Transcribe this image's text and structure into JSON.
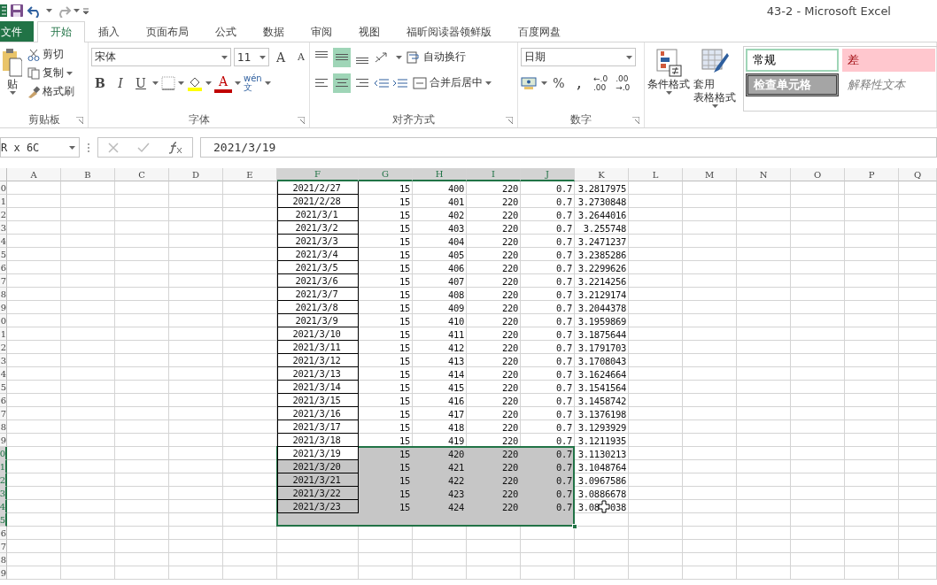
{
  "window": {
    "title": "43-2 - Microsoft Excel"
  },
  "tabs": [
    {
      "label": "文件",
      "kind": "file",
      "selected": false
    },
    {
      "label": "开始",
      "kind": "tab",
      "selected": true
    },
    {
      "label": "插入",
      "kind": "tab",
      "selected": false
    },
    {
      "label": "页面布局",
      "kind": "tab",
      "selected": false
    },
    {
      "label": "公式",
      "kind": "tab",
      "selected": false
    },
    {
      "label": "数据",
      "kind": "tab",
      "selected": false
    },
    {
      "label": "审阅",
      "kind": "tab",
      "selected": false
    },
    {
      "label": "视图",
      "kind": "tab",
      "selected": false
    },
    {
      "label": "福昕阅读器领鲜版",
      "kind": "tab",
      "selected": false
    },
    {
      "label": "百度网盘",
      "kind": "tab",
      "selected": false
    }
  ],
  "clipboard": {
    "paste": "贴",
    "cut": "剪切",
    "copy": "复制",
    "format_painter": "格式刷",
    "label": "剪贴板"
  },
  "font": {
    "name": "宋体",
    "size": "11",
    "grow": "A",
    "shrink": "A",
    "bold": "B",
    "italic": "I",
    "underline": "U",
    "color_button": "A",
    "phonetic_top": "wén",
    "phonetic_bottom": "文",
    "label": "字体"
  },
  "alignment": {
    "vertical": [
      {
        "selected": false
      },
      {
        "selected": true
      },
      {
        "selected": false
      }
    ],
    "horizontal": [
      {
        "selected": false
      },
      {
        "selected": true
      },
      {
        "selected": false
      }
    ],
    "wrap": "自动换行",
    "merge": "合并后居中",
    "label": "对齐方式"
  },
  "number": {
    "format": "日期",
    "percent": "%",
    "comma": ",",
    "decimals": [
      {
        "top": "←.0",
        "bottom": ".00"
      },
      {
        "top": ".00",
        "bottom": "→.0"
      }
    ],
    "label": "数字"
  },
  "styles": {
    "conditional": "条件格式",
    "table_top": "套用",
    "table_bottom": "表格格式",
    "gallery": [
      {
        "label": "常规",
        "kind": "normal"
      },
      {
        "label": "差",
        "kind": "bad"
      },
      {
        "label": "检查单元格",
        "kind": "check"
      },
      {
        "label": "解释性文本",
        "kind": "note"
      }
    ]
  },
  "formula_bar": {
    "name_box": "R x 6C",
    "value": "2021/3/19"
  },
  "sheet": {
    "columns": [
      {
        "label": "A",
        "selected": false
      },
      {
        "label": "B",
        "selected": false
      },
      {
        "label": "C",
        "selected": false
      },
      {
        "label": "D",
        "selected": false
      },
      {
        "label": "E",
        "selected": false
      },
      {
        "label": "F",
        "selected": true,
        "active": true
      },
      {
        "label": "G",
        "selected": true
      },
      {
        "label": "H",
        "selected": true
      },
      {
        "label": "I",
        "selected": true
      },
      {
        "label": "J",
        "selected": true
      },
      {
        "label": "K",
        "selected": false
      },
      {
        "label": "L",
        "selected": false
      },
      {
        "label": "M",
        "selected": false
      },
      {
        "label": "N",
        "selected": false
      },
      {
        "label": "O",
        "selected": false
      },
      {
        "label": "P",
        "selected": false
      },
      {
        "label": "Q",
        "selected": false
      }
    ],
    "rows": [
      {
        "header": "0",
        "selected": false,
        "cells": [
          "2021/2/27",
          "15",
          "400",
          "220",
          "0.7",
          "3.2817975"
        ]
      },
      {
        "header": "1",
        "selected": false,
        "cells": [
          "2021/2/28",
          "15",
          "401",
          "220",
          "0.7",
          "3.2730848"
        ]
      },
      {
        "header": "2",
        "selected": false,
        "cells": [
          "2021/3/1",
          "15",
          "402",
          "220",
          "0.7",
          "3.2644016"
        ]
      },
      {
        "header": "3",
        "selected": false,
        "cells": [
          "2021/3/2",
          "15",
          "403",
          "220",
          "0.7",
          "3.255748"
        ]
      },
      {
        "header": "4",
        "selected": false,
        "cells": [
          "2021/3/3",
          "15",
          "404",
          "220",
          "0.7",
          "3.2471237"
        ]
      },
      {
        "header": "5",
        "selected": false,
        "cells": [
          "2021/3/4",
          "15",
          "405",
          "220",
          "0.7",
          "3.2385286"
        ]
      },
      {
        "header": "6",
        "selected": false,
        "cells": [
          "2021/3/5",
          "15",
          "406",
          "220",
          "0.7",
          "3.2299626"
        ]
      },
      {
        "header": "7",
        "selected": false,
        "cells": [
          "2021/3/6",
          "15",
          "407",
          "220",
          "0.7",
          "3.2214256"
        ]
      },
      {
        "header": "8",
        "selected": false,
        "cells": [
          "2021/3/7",
          "15",
          "408",
          "220",
          "0.7",
          "3.2129174"
        ]
      },
      {
        "header": "9",
        "selected": false,
        "cells": [
          "2021/3/8",
          "15",
          "409",
          "220",
          "0.7",
          "3.2044378"
        ]
      },
      {
        "header": "0",
        "selected": false,
        "cells": [
          "2021/3/9",
          "15",
          "410",
          "220",
          "0.7",
          "3.1959869"
        ]
      },
      {
        "header": "1",
        "selected": false,
        "cells": [
          "2021/3/10",
          "15",
          "411",
          "220",
          "0.7",
          "3.1875644"
        ]
      },
      {
        "header": "2",
        "selected": false,
        "cells": [
          "2021/3/11",
          "15",
          "412",
          "220",
          "0.7",
          "3.1791703"
        ]
      },
      {
        "header": "3",
        "selected": false,
        "cells": [
          "2021/3/12",
          "15",
          "413",
          "220",
          "0.7",
          "3.1708043"
        ]
      },
      {
        "header": "4",
        "selected": false,
        "cells": [
          "2021/3/13",
          "15",
          "414",
          "220",
          "0.7",
          "3.1624664"
        ]
      },
      {
        "header": "5",
        "selected": false,
        "cells": [
          "2021/3/14",
          "15",
          "415",
          "220",
          "0.7",
          "3.1541564"
        ]
      },
      {
        "header": "6",
        "selected": false,
        "cells": [
          "2021/3/15",
          "15",
          "416",
          "220",
          "0.7",
          "3.1458742"
        ]
      },
      {
        "header": "7",
        "selected": false,
        "cells": [
          "2021/3/16",
          "15",
          "417",
          "220",
          "0.7",
          "3.1376198"
        ]
      },
      {
        "header": "8",
        "selected": false,
        "cells": [
          "2021/3/17",
          "15",
          "418",
          "220",
          "0.7",
          "3.1293929"
        ]
      },
      {
        "header": "9",
        "selected": false,
        "cells": [
          "2021/3/18",
          "15",
          "419",
          "220",
          "0.7",
          "3.1211935"
        ]
      },
      {
        "header": "0",
        "selected": true,
        "active": true,
        "cells": [
          "2021/3/19",
          "15",
          "420",
          "220",
          "0.7",
          "3.1130213"
        ]
      },
      {
        "header": "1",
        "selected": true,
        "cells": [
          "2021/3/20",
          "15",
          "421",
          "220",
          "0.7",
          "3.1048764"
        ]
      },
      {
        "header": "2",
        "selected": true,
        "cells": [
          "2021/3/21",
          "15",
          "422",
          "220",
          "0.7",
          "3.0967586"
        ]
      },
      {
        "header": "3",
        "selected": true,
        "cells": [
          "2021/3/22",
          "15",
          "423",
          "220",
          "0.7",
          "3.0886678"
        ]
      },
      {
        "header": "4",
        "selected": true,
        "pointer": true,
        "cells": [
          "2021/3/23",
          "15",
          "424",
          "220",
          "0.7",
          "3.08  038"
        ]
      },
      {
        "header": "5",
        "selected": true
      },
      {
        "header": "6",
        "selected": false
      },
      {
        "header": "7",
        "selected": false
      },
      {
        "header": "8",
        "selected": false
      },
      {
        "header": "9",
        "selected": false
      }
    ]
  }
}
